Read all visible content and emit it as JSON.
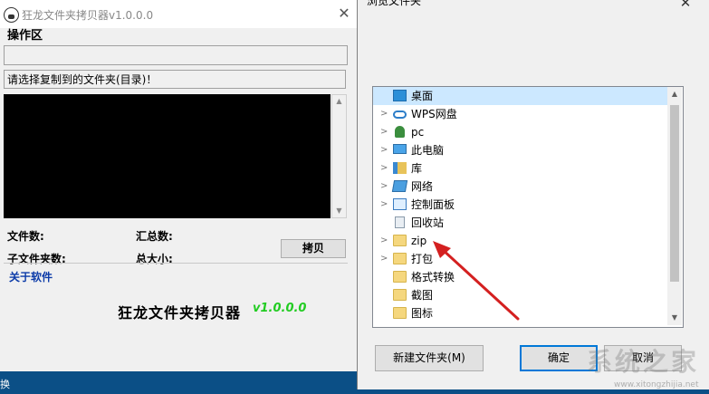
{
  "app": {
    "title": "狂龙文件夹拷贝器v1.0.0.0",
    "close": "✕",
    "section_label": "操作区",
    "prompt": "请选择复制到的文件夹(目录)！",
    "file_count_label": "文件数:",
    "total_count_label": "汇总数:",
    "subfolder_count_label": "子文件夹数:",
    "total_size_label": "总大小:",
    "copy_button": "拷贝",
    "about_link": "关于软件",
    "big_title": "狂龙文件夹拷贝器",
    "version": "v1.0.0.0"
  },
  "dialog": {
    "title": "浏览文件夹",
    "close": "✕",
    "tree": [
      {
        "label": "桌面",
        "icon": "desktop-icon",
        "chevron": false,
        "selected": true
      },
      {
        "label": "WPS网盘",
        "icon": "cloud-icon",
        "chevron": true
      },
      {
        "label": "pc",
        "icon": "user-icon",
        "chevron": true
      },
      {
        "label": "此电脑",
        "icon": "computer-icon",
        "chevron": true
      },
      {
        "label": "库",
        "icon": "library-icon",
        "chevron": true
      },
      {
        "label": "网络",
        "icon": "network-icon",
        "chevron": true
      },
      {
        "label": "控制面板",
        "icon": "control-panel-icon",
        "chevron": true
      },
      {
        "label": "回收站",
        "icon": "recycle-bin-icon",
        "chevron": false
      },
      {
        "label": "zip",
        "icon": "folder-icon",
        "chevron": true
      },
      {
        "label": "打包",
        "icon": "folder-icon",
        "chevron": true
      },
      {
        "label": "格式转换",
        "icon": "folder-icon",
        "chevron": false
      },
      {
        "label": "截图",
        "icon": "folder-icon",
        "chevron": false
      },
      {
        "label": "图标",
        "icon": "folder-icon",
        "chevron": false
      }
    ],
    "new_folder_button": "新建文件夹(M)",
    "ok_button": "确定",
    "cancel_button": "取消"
  },
  "desktop": {
    "taskbar_text": "换"
  },
  "watermark": {
    "text": "系统之家",
    "url": "www.xitongzhijia.net"
  },
  "colors": {
    "accent": "#0078d7",
    "selection": "#cce8ff",
    "version_green": "#22cc22",
    "link_blue": "#0b3aa8",
    "arrow_red": "#d42020"
  }
}
